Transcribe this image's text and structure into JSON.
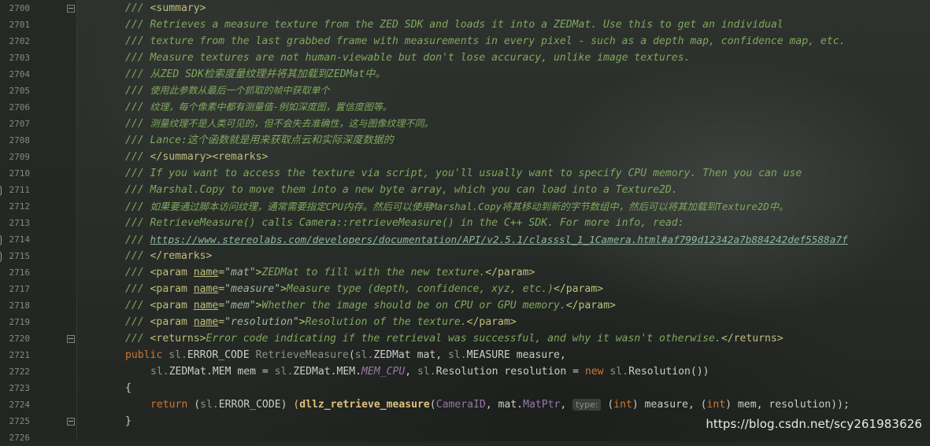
{
  "editor": {
    "line_numbers": [
      "2700",
      "2701",
      "2702",
      "2703",
      "2704",
      "2705",
      "2706",
      "2707",
      "2708",
      "2709",
      "2710",
      "2711",
      "2712",
      "2713",
      "2714",
      "2715",
      "2716",
      "2717",
      "2718",
      "2719",
      "2720",
      "2721",
      "2722",
      "2723",
      "2724",
      "2725",
      "2726"
    ],
    "slash": "/// ",
    "tags": {
      "summary_open": "<summary>",
      "summary_close": "</summary>",
      "remarks_open": "<remarks>",
      "remarks_close": "</remarks>",
      "param_open": "<param ",
      "param_close": "</param>",
      "name_attr": "name",
      "returns_open": "<returns>",
      "returns_close": "</returns>"
    },
    "summary_text": {
      "l2701": "Retrieves a measure texture from the ZED SDK and loads it into a ZEDMat. Use this to get an individual",
      "l2702": "texture from the last grabbed frame with measurements in every pixel - such as a depth map, confidence map, etc.",
      "l2703": "Measure textures are not human-viewable but don't lose accuracy, unlike image textures.",
      "l2704": "从ZED SDK检索度量纹理并将其加载到ZEDMat中。",
      "l2705": "使用此参数从最后一个抓取的帧中获取单个",
      "l2706": "纹理，每个像素中都有测量值-例如深度图，置信度图等。",
      "l2707": "测量纹理不是人类可见的，但不会失去准确性，这与图像纹理不同。",
      "l2708": "Lance:这个函数就是用来获取点云和实际深度数据的"
    },
    "remarks_text": {
      "l2710": "If you want to access the texture via script, you'll usually want to specify CPU memory. Then you can use",
      "l2711": "Marshal.Copy to move them into a new byte array, which you can load into a Texture2D.",
      "l2712": "如果要通过脚本访问纹理，通常需要指定CPU内存。然后可以使用Marshal.Copy将其移动到新的字节数组中，然后可以将其加载到Texture2D中。",
      "l2713": "RetrieveMeasure() calls Camera::retrieveMeasure() in the C++ SDK. For more info, read:",
      "l2714_link": "https://www.stereolabs.com/developers/documentation/API/v2.5.1/classsl_1_1Camera.html#af799d12342a7b884242def5588a7f"
    },
    "params": [
      {
        "name": "\"mat\"",
        "desc": "ZEDMat to fill with the new texture."
      },
      {
        "name": "\"measure\"",
        "desc": "Measure type (depth, confidence, xyz, etc.)"
      },
      {
        "name": "\"mem\"",
        "desc": "Whether the image should be on CPU or GPU memory."
      },
      {
        "name": "\"resolution\"",
        "desc": "Resolution of the texture."
      }
    ],
    "returns_text": "Error code indicating if the retrieval was successful, and why it wasn't otherwise.",
    "code": {
      "kw_public": "public",
      "sl1": "sl.",
      "error_code": "ERROR_CODE",
      "method": "RetrieveMeasure",
      "open_paren": "(",
      "sl2": "sl.",
      "zedmat_mat": "ZEDMat mat",
      "comma1": ", ",
      "sl3": "sl.",
      "measure_measure": "MEASURE measure,",
      "l2722_a": "sl.",
      "l2722_b": "ZEDMat.MEM mem = ",
      "l2722_c": "sl.",
      "l2722_d": "ZEDMat.MEM.",
      "mem_cpu": "MEM_CPU",
      "l2722_e": ", ",
      "l2722_f": "sl.",
      "l2722_g": "Resolution resolution = ",
      "kw_new": "new",
      "l2722_h": " ",
      "l2722_i": "sl.",
      "l2722_j": "Resolution())",
      "brace_open": "{",
      "kw_return": "return",
      "l2724_a": " (",
      "l2724_b": "sl.",
      "l2724_c": "ERROR_CODE) ",
      "l2724_paren": "(",
      "dllz_fn": "dllz_retrieve_measure",
      "l2724_d": "(",
      "camera_id": "CameraID",
      "l2724_e": ", mat.",
      "mat_ptr": "MatPtr",
      "l2724_f": ", ",
      "type_hint": "type:",
      "l2724_g": " (",
      "kw_int1": "int",
      "l2724_h": ") measure, (",
      "kw_int2": "int",
      "l2724_i": ") mem, resolution));",
      "brace_close": "}"
    }
  },
  "watermark": "https://blog.csdn.net/scy261983626"
}
